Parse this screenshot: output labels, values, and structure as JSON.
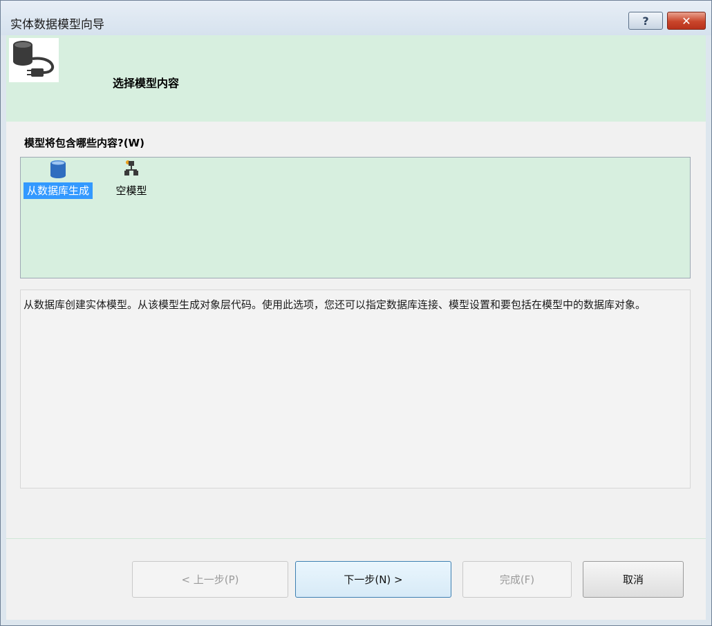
{
  "window": {
    "title": "实体数据模型向导",
    "help_label": "?",
    "close_label": "✕"
  },
  "header": {
    "title": "选择模型内容",
    "icon": "database-connect-icon"
  },
  "content": {
    "question": "模型将包含哪些内容?(W)",
    "options": [
      {
        "label": "从数据库生成",
        "icon": "database-icon",
        "selected": true
      },
      {
        "label": "空模型",
        "icon": "empty-model-icon",
        "selected": false
      }
    ],
    "description": "从数据库创建实体模型。从该模型生成对象层代码。使用此选项，您还可以指定数据库连接、模型设置和要包括在模型中的数据库对象。"
  },
  "footer": {
    "back_label": "< 上一步(P)",
    "next_label": "下一步(N) >",
    "finish_label": "完成(F)",
    "cancel_label": "取消"
  },
  "colors": {
    "header_bg": "#d7efdf",
    "selection": "#3399ff",
    "close_button": "#c9452a"
  }
}
